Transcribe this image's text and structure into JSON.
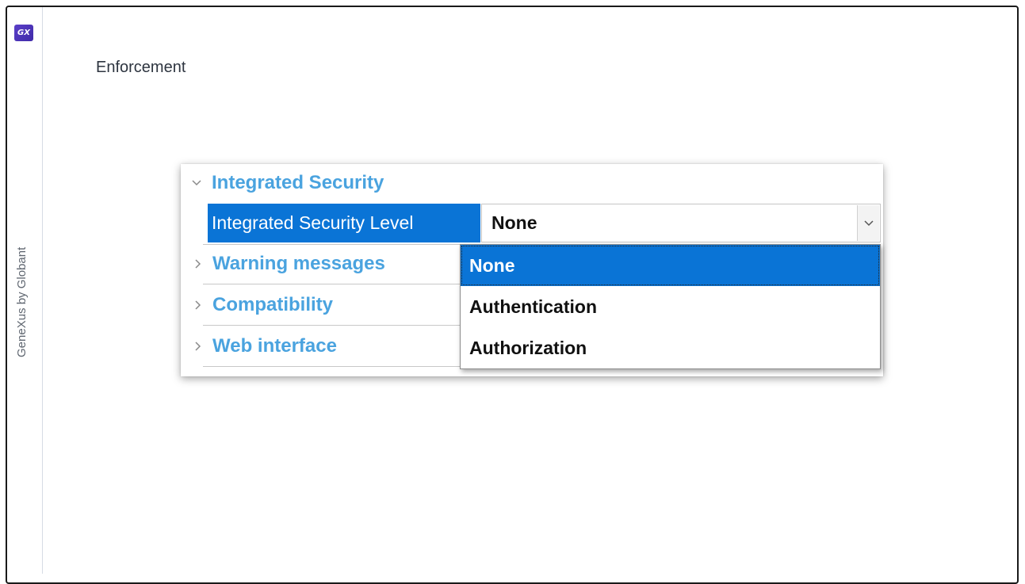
{
  "brand": {
    "logo_text": "GX",
    "vertical_text": "GeneXus by Globant",
    "logo_color": "#4b33b8"
  },
  "page": {
    "title": "Enforcement"
  },
  "properties": {
    "categories": [
      {
        "label": "Integrated Security",
        "expanded": true,
        "icon": "chevron-down-icon"
      },
      {
        "label": "Warning messages",
        "expanded": false,
        "icon": "chevron-right-icon"
      },
      {
        "label": "Compatibility",
        "expanded": false,
        "icon": "chevron-right-icon"
      },
      {
        "label": "Web interface",
        "expanded": false,
        "icon": "chevron-right-icon"
      }
    ],
    "selected_property": {
      "name": "Integrated Security Level",
      "value": "None"
    },
    "dropdown_options": [
      "None",
      "Authentication",
      "Authorization"
    ],
    "selected_option_index": 0
  },
  "colors": {
    "accent_blue": "#0a74d6",
    "category_text": "#4aa3df"
  }
}
